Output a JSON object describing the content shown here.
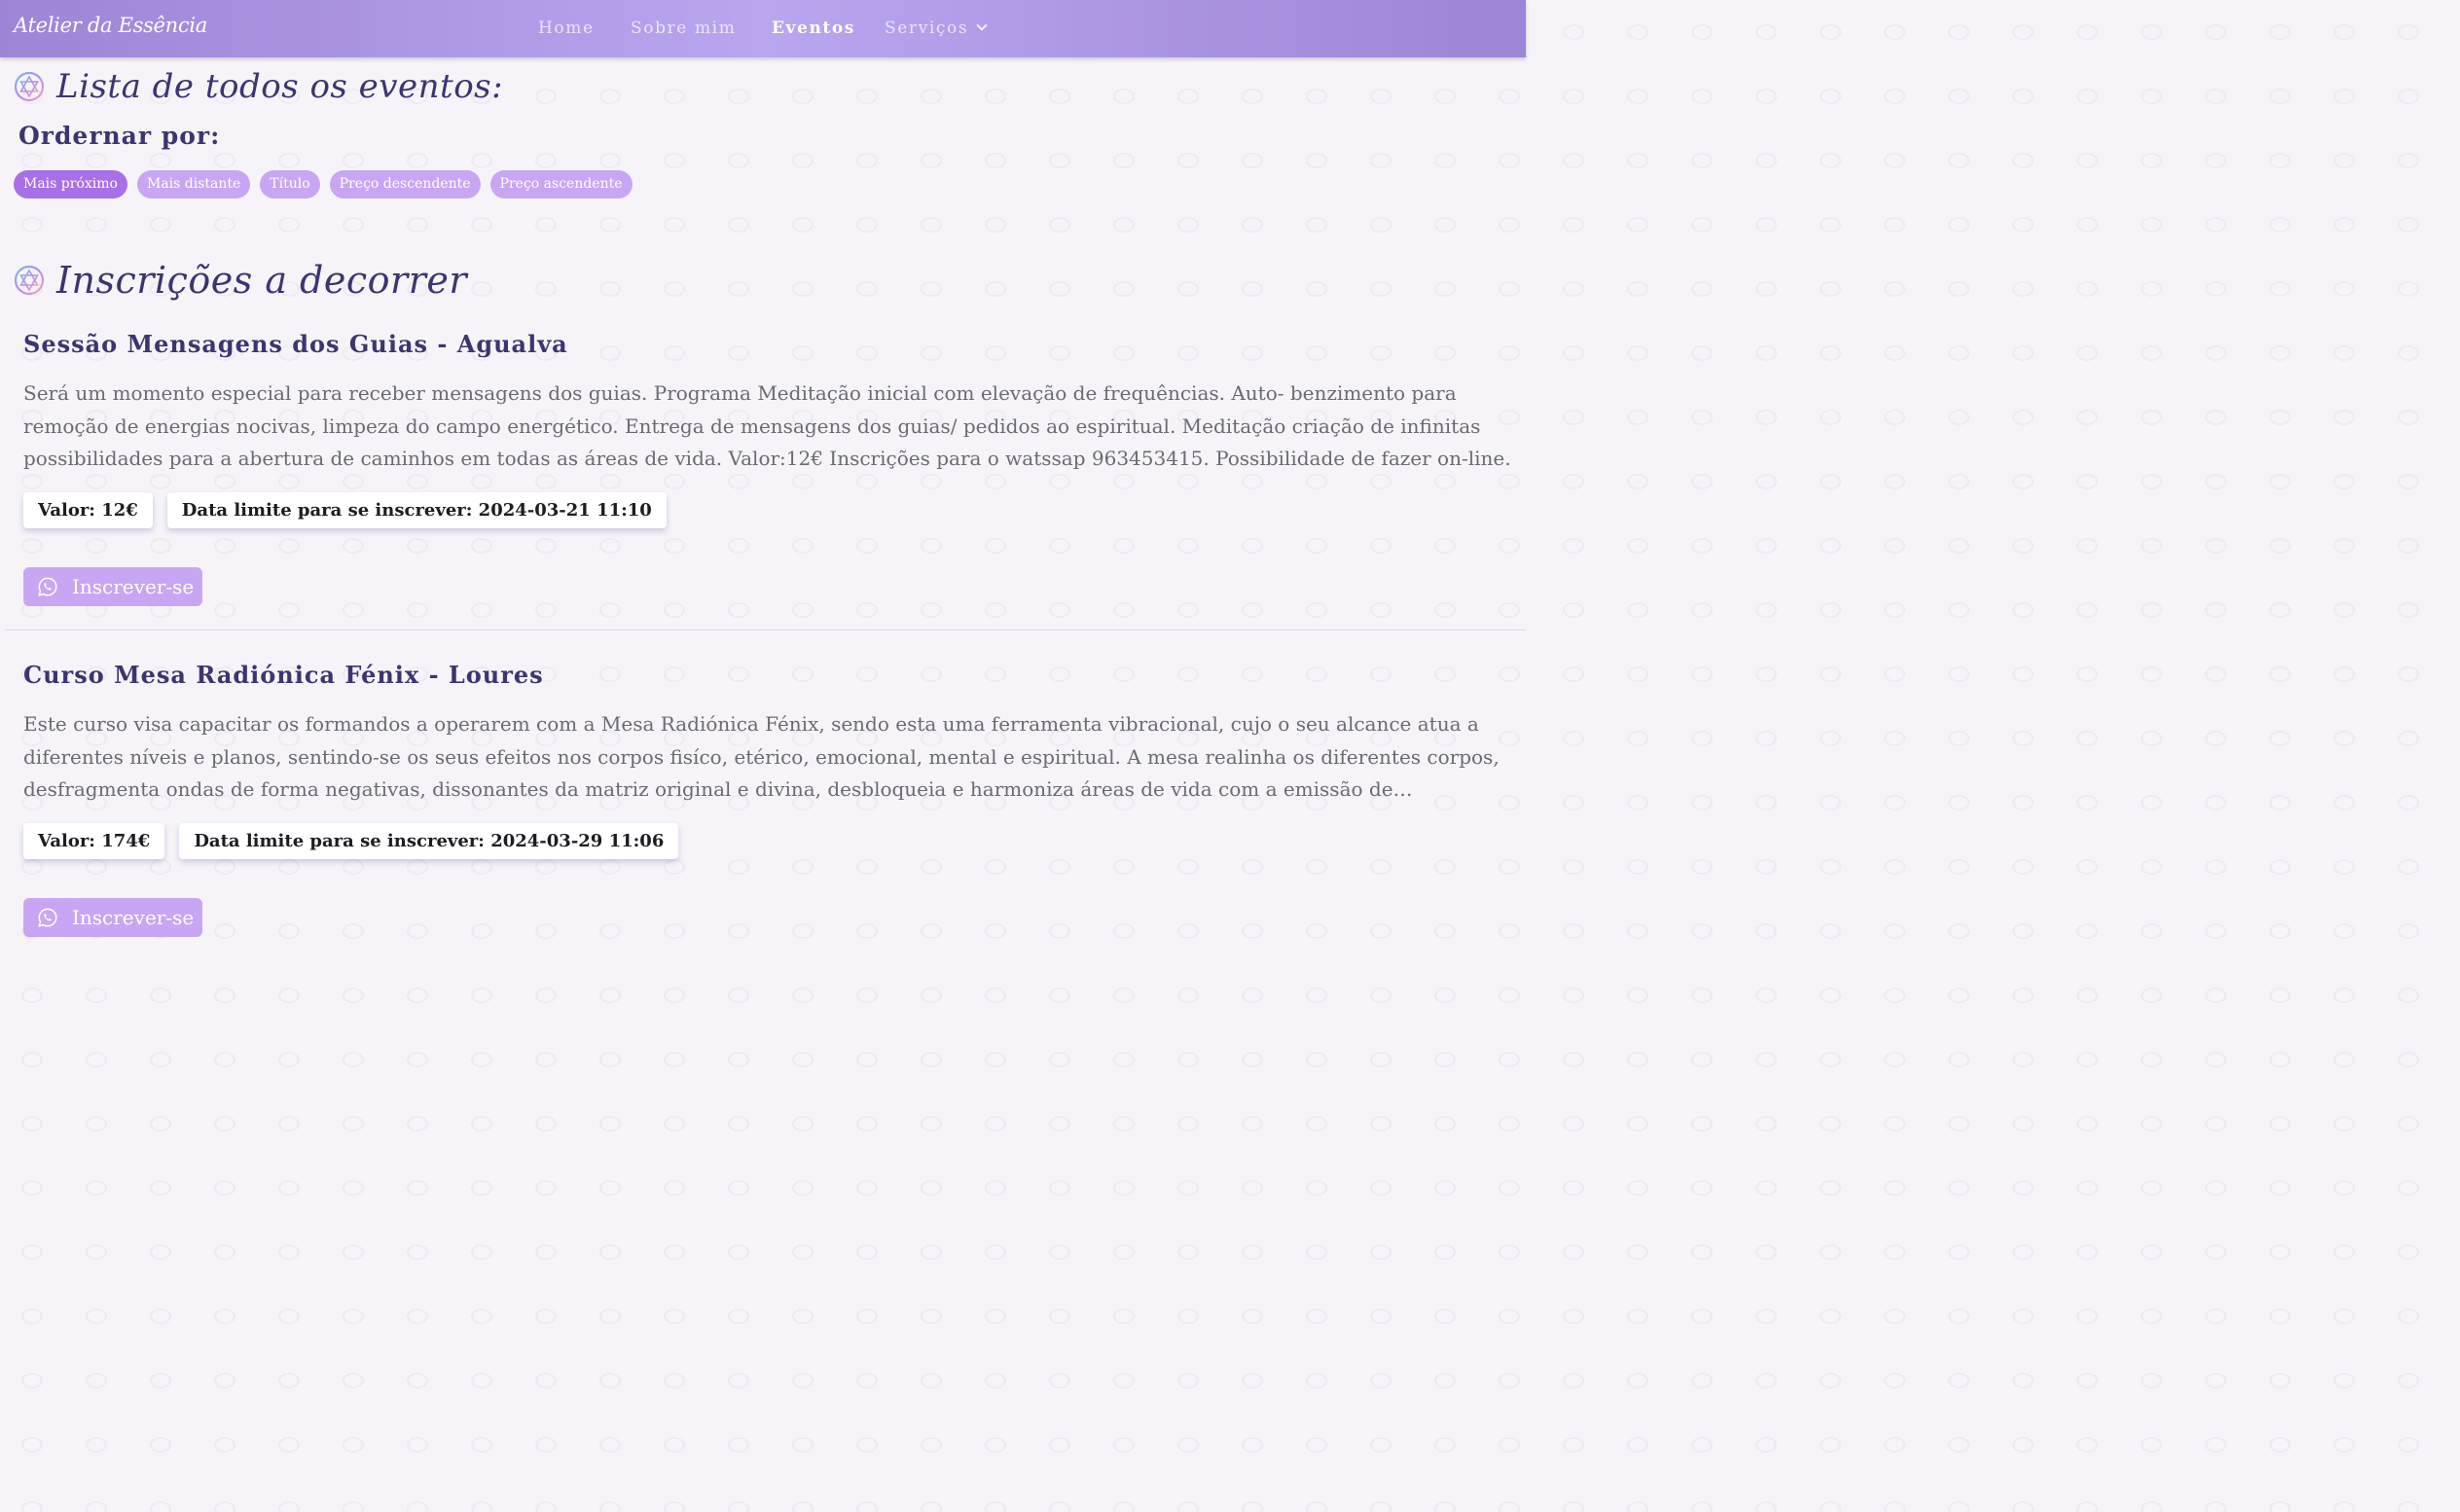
{
  "brand": "Atelier da Essência",
  "nav": {
    "home": "Home",
    "about": "Sobre mim",
    "events": "Eventos",
    "services": "Serviços"
  },
  "all_events_title": "Lista de todos os eventos:",
  "order_label": "Ordernar por:",
  "sort_options": [
    "Mais próximo",
    "Mais distante",
    "Título",
    "Preço descendente",
    "Preço ascendente"
  ],
  "active_sort": "Mais próximo",
  "ongoing_title": "Inscrições a decorrer",
  "events": [
    {
      "title": "Sessão Mensagens dos Guias - Agualva",
      "description": "Será um momento especial para receber mensagens dos guias. Programa Meditação inicial com elevação de frequências. Auto- benzimento para remoção de energias nocivas, limpeza do campo energético. Entrega de mensagens dos guias/ pedidos ao espiritual. Meditação criação de infinitas possibilidades para a abertura de caminhos em todas as áreas de vida. Valor:12€ Inscrições para o watssap 963453415. Possibilidade de fazer on-line.",
      "price": "Valor: 12€",
      "deadline": "Data limite para se inscrever: 2024-03-21 11:10",
      "button": "Inscrever-se"
    },
    {
      "title": "Curso Mesa Radiónica Fénix - Loures",
      "description": "Este curso visa capacitar os formandos a operarem com a Mesa Radiónica Fénix, sendo esta uma ferramenta vibracional, cujo o seu alcance atua a diferentes níveis e planos, sentindo-se os seus efeitos nos corpos fisíco, etérico, emocional, mental e espiritual. A mesa realinha os diferentes corpos, desfragmenta ondas de forma negativas, dissonantes da matriz original e divina, desbloqueia e harmoniza áreas de vida com a emissão de frequências.",
      "price": "Valor: 174€",
      "deadline": "Data limite para se inscrever: 2024-03-29 11:06",
      "button": "Inscrever-se"
    }
  ],
  "colors": {
    "navbar": "#b9a6ef",
    "accent": "#a86fe6",
    "pill": "#c8a6f3",
    "heading": "#3e3470"
  },
  "icons": {
    "heading": "star-of-david-icon",
    "button": "whatsapp-icon",
    "dropdown": "chevron-down-icon"
  }
}
